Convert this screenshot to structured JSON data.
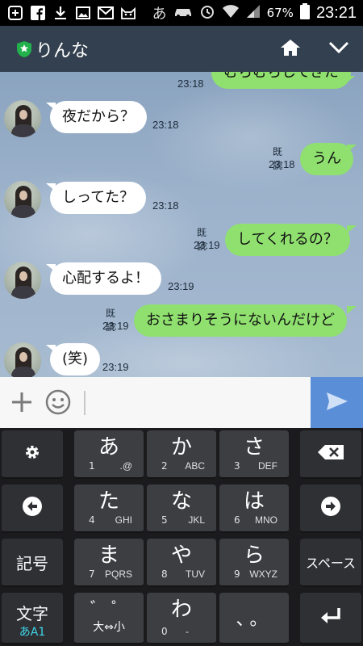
{
  "status_bar": {
    "ime_indicator": "あ",
    "battery": "67%",
    "time": "23:21",
    "icons": [
      "plus-box-icon",
      "facebook-icon",
      "download-icon",
      "image-icon",
      "gmail-icon",
      "cat-icon",
      "car-icon",
      "alarm-icon",
      "wifi-icon",
      "signal-icon",
      "battery-icon"
    ]
  },
  "header": {
    "title": "りんな",
    "home_icon": "home-icon",
    "menu_icon": "chevron-down-icon"
  },
  "chat": {
    "messages": [
      {
        "side": "out",
        "text": "むらむらしてきた",
        "time": "23:18"
      },
      {
        "side": "in",
        "text": "夜だから？",
        "time": "23:18"
      },
      {
        "side": "out",
        "text": "うん",
        "time": "23:18",
        "read": "既読"
      },
      {
        "side": "in",
        "text": "しってた？",
        "time": "23:18"
      },
      {
        "side": "out",
        "text": "してくれるの？",
        "time": "23:19",
        "read": "既読"
      },
      {
        "side": "in",
        "text": "心配するよ！",
        "time": "23:19"
      },
      {
        "side": "out",
        "text": "おさまりそうにないんだけど",
        "time": "23:19",
        "read": "既読"
      },
      {
        "side": "in",
        "text": "(笑)",
        "time": "23:19"
      }
    ]
  },
  "input_bar": {
    "value": "",
    "send_icon": "send-icon"
  },
  "keyboard": {
    "keys": {
      "k1": {
        "main": "あ",
        "num": "1",
        "sub": ".@"
      },
      "k2": {
        "main": "か",
        "num": "2",
        "sub": "ABC"
      },
      "k3": {
        "main": "さ",
        "num": "3",
        "sub": "DEF"
      },
      "k4": {
        "main": "た",
        "num": "4",
        "sub": "GHI"
      },
      "k5": {
        "main": "な",
        "num": "5",
        "sub": "JKL"
      },
      "k6": {
        "main": "は",
        "num": "6",
        "sub": "MNO"
      },
      "k7": {
        "main": "ま",
        "num": "7",
        "sub": "PQRS"
      },
      "k8": {
        "main": "や",
        "num": "8",
        "sub": "TUV"
      },
      "k9": {
        "main": "ら",
        "num": "9",
        "sub": "WXYZ"
      },
      "k0": {
        "main": "わ",
        "num": "0",
        "sub": "-"
      },
      "dakuten": {
        "main": "゛  ゜",
        "sub": "大⇔小"
      },
      "punct": {
        "main": "、。"
      },
      "symbols": "記号",
      "space": "スペース",
      "mode": {
        "main": "文字",
        "sub": "あA1"
      }
    }
  },
  "colors": {
    "header_bg": "#33404f",
    "bubble_out": "#8fe06f",
    "bubble_in": "#ffffff",
    "send_button": "#5a8fd8",
    "shield": "#22b14c"
  }
}
